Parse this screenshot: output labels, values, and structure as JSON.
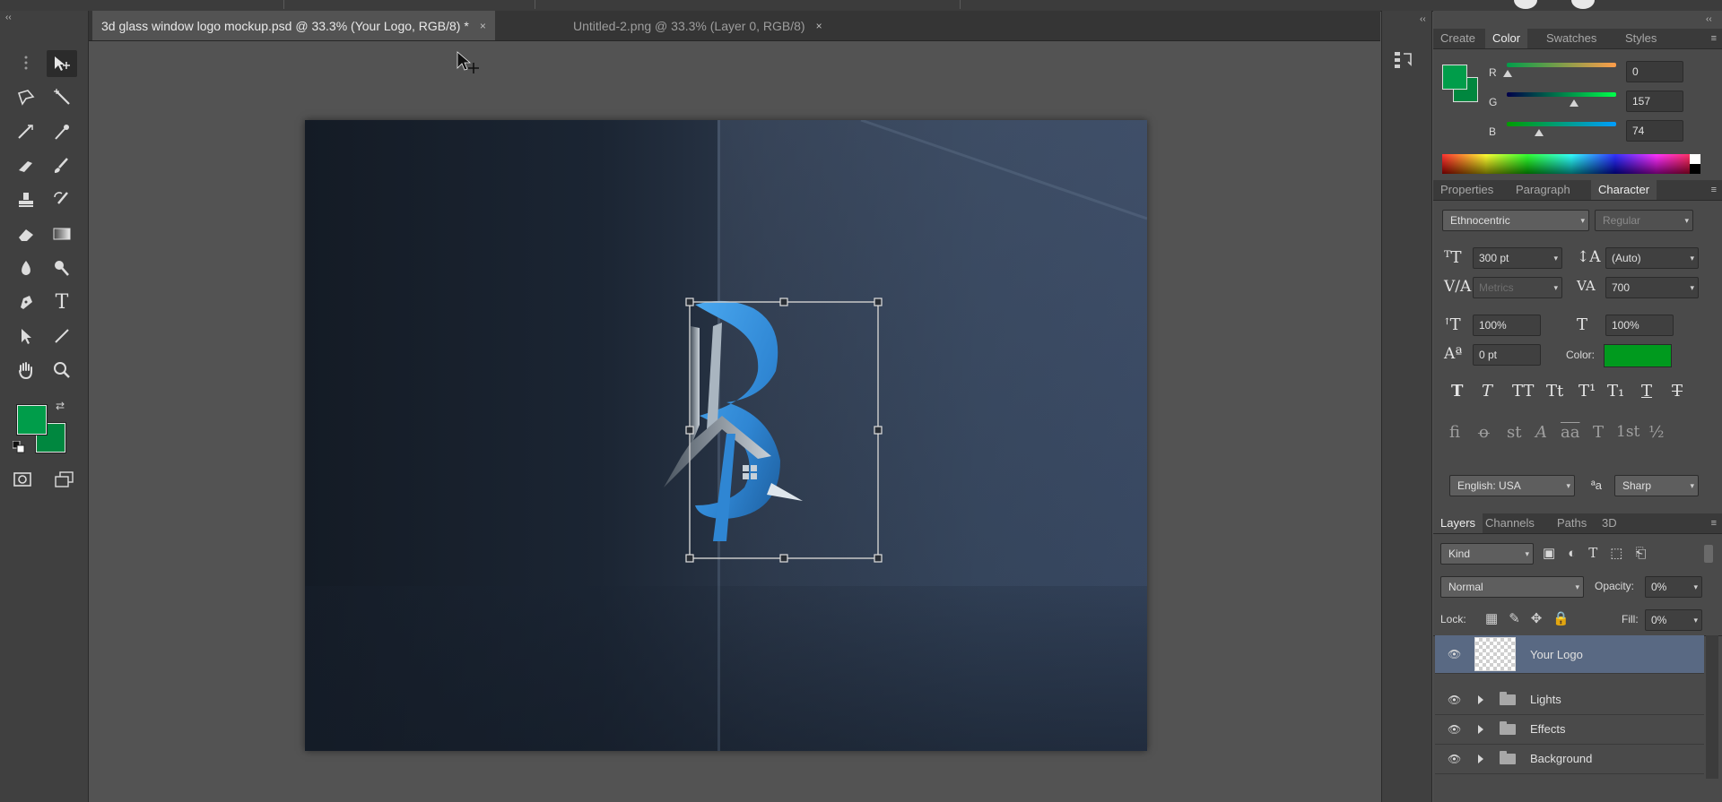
{
  "tabs": [
    {
      "label": "3d glass window logo mockup.psd @ 33.3% (Your Logo, RGB/8) *",
      "close": "×"
    },
    {
      "label": "Untitled-2.png @ 33.3% (Layer 0, RGB/8)",
      "close": "×"
    }
  ],
  "toolbar": {
    "collapse": "‹‹",
    "foreground_color": "#009d4a",
    "background_color": "#00873f",
    "tools": [
      "move-tool",
      "lasso-tool",
      "magic-wand-tool",
      "crop-tool",
      "eyedropper-tool",
      "healing-brush-tool",
      "brush-tool",
      "clone-stamp-tool",
      "history-brush-tool",
      "eraser-tool",
      "gradient-tool",
      "blur-tool",
      "dodge-tool",
      "pen-tool",
      "type-tool",
      "path-selection-tool",
      "line-tool",
      "hand-tool",
      "zoom-tool"
    ],
    "type_tool_glyph": "T"
  },
  "panel_collapse": "‹‹",
  "color_panel": {
    "tabs": [
      "Create",
      "Color",
      "Swatches",
      "Styles"
    ],
    "active_tab": "Color",
    "r_label": "R",
    "g_label": "G",
    "b_label": "B",
    "r": "0",
    "g": "157",
    "b": "74",
    "swatch_color": "#009d4a"
  },
  "character_panel": {
    "tabs": [
      "Properties",
      "Paragraph",
      "Character"
    ],
    "active_tab": "Character",
    "font_family": "Ethnocentric",
    "font_style": "Regular",
    "font_size": "300 pt",
    "leading": "(Auto)",
    "kerning": "Metrics",
    "tracking": "700",
    "vertical_scale": "100%",
    "horizontal_scale": "100%",
    "baseline_shift": "0 pt",
    "color_label": "Color:",
    "text_color": "#009a1e",
    "style_buttons": [
      "T",
      "T",
      "TT",
      "Tt",
      "T¹",
      "T₁",
      "T",
      "T"
    ],
    "opentype_buttons": [
      "fi",
      "ꝋ",
      "st",
      "A",
      "aa",
      "T",
      "1st",
      "½"
    ],
    "language": "English: USA",
    "aa_label": "ªa",
    "antialias": "Sharp"
  },
  "layers_panel": {
    "tabs": [
      "Layers",
      "Channels",
      "Paths",
      "3D"
    ],
    "active_tab": "Layers",
    "filter_kind": "Kind",
    "blend_mode": "Normal",
    "opacity_label": "Opacity:",
    "opacity": "0%",
    "lock_label": "Lock:",
    "fill_label": "Fill:",
    "fill": "0%",
    "layers": [
      {
        "name": "Your Logo",
        "type": "smart-object",
        "selected": true
      },
      {
        "name": "Lights",
        "type": "group",
        "selected": false
      },
      {
        "name": "Effects",
        "type": "group",
        "selected": false
      },
      {
        "name": "Background",
        "type": "group",
        "selected": false
      }
    ]
  }
}
